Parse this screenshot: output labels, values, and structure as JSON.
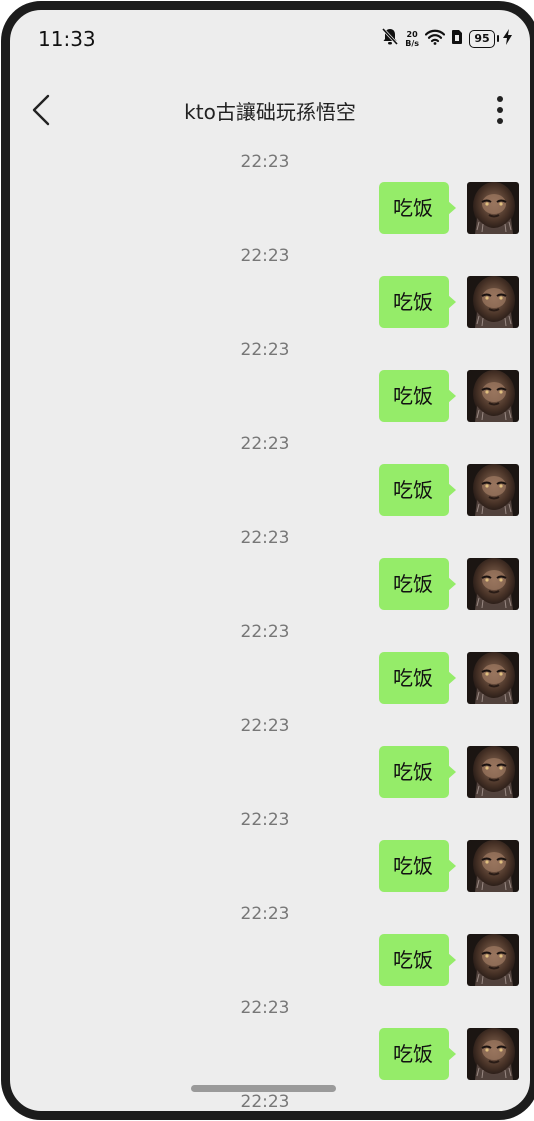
{
  "status_bar": {
    "time": "11:33",
    "net_speed_value": "20",
    "net_speed_unit": "B/s",
    "battery_level": "95",
    "icons": [
      "bell-off-icon",
      "wifi-icon",
      "sim-icon",
      "battery-icon",
      "charging-icon"
    ]
  },
  "header": {
    "title": "kto古讓础玩孫悟空",
    "back_icon": "chevron-left-icon",
    "more_icon": "more-vertical-icon"
  },
  "messages": [
    {
      "time": "22:23",
      "text": "吃饭",
      "sender": "self"
    },
    {
      "time": "22:23",
      "text": "吃饭",
      "sender": "self"
    },
    {
      "time": "22:23",
      "text": "吃饭",
      "sender": "self"
    },
    {
      "time": "22:23",
      "text": "吃饭",
      "sender": "self"
    },
    {
      "time": "22:23",
      "text": "吃饭",
      "sender": "self"
    },
    {
      "time": "22:23",
      "text": "吃饭",
      "sender": "self"
    },
    {
      "time": "22:23",
      "text": "吃饭",
      "sender": "self"
    },
    {
      "time": "22:23",
      "text": "吃饭",
      "sender": "self"
    },
    {
      "time": "22:23",
      "text": "吃饭",
      "sender": "self"
    },
    {
      "time": "22:23",
      "text": "吃饭",
      "sender": "self"
    },
    {
      "time": "22:23",
      "text": "",
      "sender": "self"
    }
  ],
  "colors": {
    "background": "#ededed",
    "bubble": "#95ec69",
    "timestamp": "#777777",
    "frame": "#1c1c1c"
  }
}
